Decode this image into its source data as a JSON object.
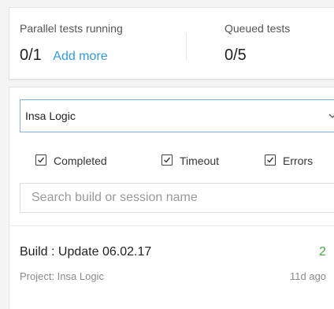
{
  "stats": {
    "parallel": {
      "label": "Parallel tests running",
      "value": "0/1",
      "action_label": "Add more"
    },
    "queued": {
      "label": "Queued tests",
      "value": "0/5"
    }
  },
  "filters": {
    "project": {
      "selected": "Insa Logic",
      "icon": "chevron-down-icon"
    },
    "status_options": [
      {
        "label": "Completed",
        "checked": true
      },
      {
        "label": "Timeout",
        "checked": true
      },
      {
        "label": "Errors",
        "checked": true
      }
    ],
    "search": {
      "placeholder": "Search build or session name",
      "value": ""
    }
  },
  "builds": [
    {
      "name": "Build : Update 06.02.17",
      "project": "Project: Insa Logic",
      "count": "2",
      "age": "11d ago"
    }
  ],
  "colors": {
    "accent": "#2f9be0",
    "success": "#3fa845",
    "select_border": "#7fb1e3"
  }
}
